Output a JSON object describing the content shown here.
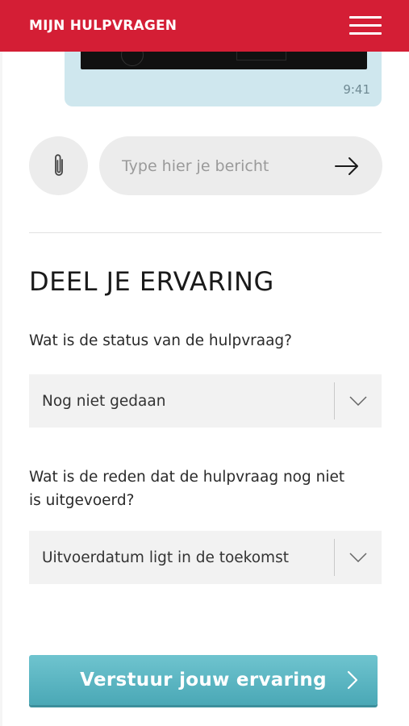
{
  "header": {
    "title": "MIJN HULPVRAGEN",
    "menu_icon": "hamburger-icon",
    "brand_color": "#d41e35"
  },
  "chat": {
    "last_message_time": "9:41",
    "attach_icon": "paperclip-icon",
    "input_placeholder": "Type hier je bericht",
    "input_value": "",
    "send_icon": "arrow-right-icon",
    "bubble_color": "#cfe7ee"
  },
  "feedback": {
    "title": "DEEL JE ERVARING",
    "status_question": "Wat is de status van de hulpvraag?",
    "status_selected": "Nog niet gedaan",
    "reason_question": "Wat is de reden dat de hulpvraag nog niet is uitgevoerd?",
    "reason_selected": "Uitvoerdatum ligt in de toekomst",
    "submit_label": "Verstuur jouw ervaring",
    "submit_color": "#5bb7c3"
  }
}
